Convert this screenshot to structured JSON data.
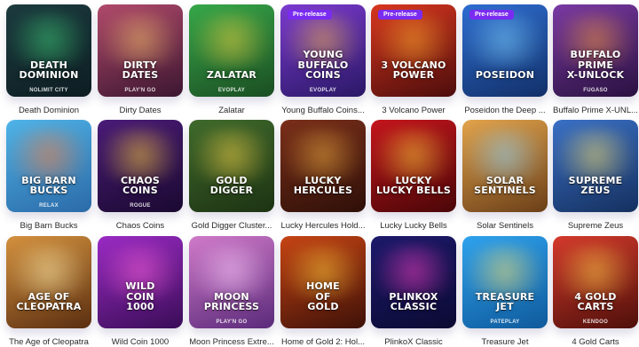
{
  "badge_text": "Pre-release",
  "games": [
    {
      "title": "Death Dominion",
      "logo": "Death\nDominion",
      "provider": "Nolimit City",
      "bg": [
        "#1c3b3f",
        "#0d1d22"
      ],
      "glow": "#3fd17a",
      "prerelease": false
    },
    {
      "title": "Dirty Dates",
      "logo": "Dirty\nDates",
      "provider": "Play'n GO",
      "bg": [
        "#b14a6c",
        "#3b1630"
      ],
      "glow": "#f6c46a",
      "prerelease": false
    },
    {
      "title": "Zalatar",
      "logo": "Zalatar",
      "provider": "Evoplay",
      "bg": [
        "#36a84a",
        "#1b4d22"
      ],
      "glow": "#f4d240",
      "prerelease": false
    },
    {
      "title": "Young Buffalo Coins...",
      "logo": "Young\nBuffalo\nCoins",
      "provider": "Evoplay",
      "bg": [
        "#7b3ad0",
        "#2a1866"
      ],
      "glow": "#f3b94a",
      "prerelease": true
    },
    {
      "title": "3 Volcano Power",
      "logo": "3 Volcano\nPower",
      "provider": "",
      "bg": [
        "#d8361f",
        "#4d0d0c"
      ],
      "glow": "#ffb02e",
      "prerelease": true
    },
    {
      "title": "Poseidon the Deep ...",
      "logo": "Poseidon",
      "provider": "",
      "bg": [
        "#2e6dd0",
        "#123069"
      ],
      "glow": "#7fd3ff",
      "prerelease": true
    },
    {
      "title": "Buffalo Prime X-UNL...",
      "logo": "Buffalo\nPrime\nX-Unlock",
      "provider": "Fugaso",
      "bg": [
        "#7a3aa4",
        "#2a1140"
      ],
      "glow": "#f59a3c",
      "prerelease": false
    },
    {
      "title": "Big Barn Bucks",
      "logo": "Big Barn\nBucks",
      "provider": "Relax",
      "bg": [
        "#4fb4e8",
        "#2b6aa8"
      ],
      "glow": "#ff7d3a",
      "prerelease": false
    },
    {
      "title": "Chaos Coins",
      "logo": "Chaos\nCoins",
      "provider": "Rogue",
      "bg": [
        "#4a1b78",
        "#1a0930"
      ],
      "glow": "#ffd23d",
      "prerelease": false
    },
    {
      "title": "Gold Digger Cluster...",
      "logo": "Gold\nDigger",
      "provider": "",
      "bg": [
        "#3f6a2c",
        "#1d3313"
      ],
      "glow": "#ffd84a",
      "prerelease": false
    },
    {
      "title": "Lucky Hercules Hold...",
      "logo": "Lucky\nHercules",
      "provider": "",
      "bg": [
        "#7a2f1a",
        "#2e0f08"
      ],
      "glow": "#f1b243",
      "prerelease": false
    },
    {
      "title": "Lucky Lucky Bells",
      "logo": "Lucky\nLucky Bells",
      "provider": "",
      "bg": [
        "#c4151c",
        "#4a0608"
      ],
      "glow": "#ffd43c",
      "prerelease": false
    },
    {
      "title": "Solar Sentinels",
      "logo": "Solar\nSentinels",
      "provider": "",
      "bg": [
        "#e2a34b",
        "#6b3f18"
      ],
      "glow": "#8fd6ff",
      "prerelease": false
    },
    {
      "title": "Supreme Zeus",
      "logo": "Supreme\nZeus",
      "provider": "",
      "bg": [
        "#3a70c6",
        "#15305f"
      ],
      "glow": "#ffe36b",
      "prerelease": false
    },
    {
      "title": "The Age of Cleopatra",
      "logo": "Age of\nCleopatra",
      "provider": "",
      "bg": [
        "#d4913e",
        "#5a2e10"
      ],
      "glow": "#fff0b0",
      "prerelease": false
    },
    {
      "title": "Wild Coin 1000",
      "logo": "Wild\nCoin\n1000",
      "provider": "",
      "bg": [
        "#9a2bc4",
        "#3a0d57"
      ],
      "glow": "#ff63d8",
      "prerelease": false
    },
    {
      "title": "Moon Princess Extre...",
      "logo": "Moon\nPrincess",
      "provider": "Play'n GO",
      "bg": [
        "#d07ac9",
        "#5a2a7a"
      ],
      "glow": "#ffd0ff",
      "prerelease": false
    },
    {
      "title": "Home of Gold 2: Hol...",
      "logo": "Home\nof\nGold",
      "provider": "",
      "bg": [
        "#c64414",
        "#3e1108"
      ],
      "glow": "#ffce3a",
      "prerelease": false
    },
    {
      "title": "PlinkoX Classic",
      "logo": "PlinkoX\nClassic",
      "provider": "",
      "bg": [
        "#1c1a6b",
        "#0b0a33"
      ],
      "glow": "#ff3fc5",
      "prerelease": false
    },
    {
      "title": "Treasure Jet",
      "logo": "Treasure\nJet",
      "provider": "Pateplay",
      "bg": [
        "#2ea2ee",
        "#0f5a9c"
      ],
      "glow": "#ffe46a",
      "prerelease": false
    },
    {
      "title": "4 Gold Carts",
      "logo": "4 Gold\nCarts",
      "provider": "Kendoo",
      "bg": [
        "#d43a2c",
        "#4e0f0a"
      ],
      "glow": "#ffd34a",
      "prerelease": false
    }
  ]
}
